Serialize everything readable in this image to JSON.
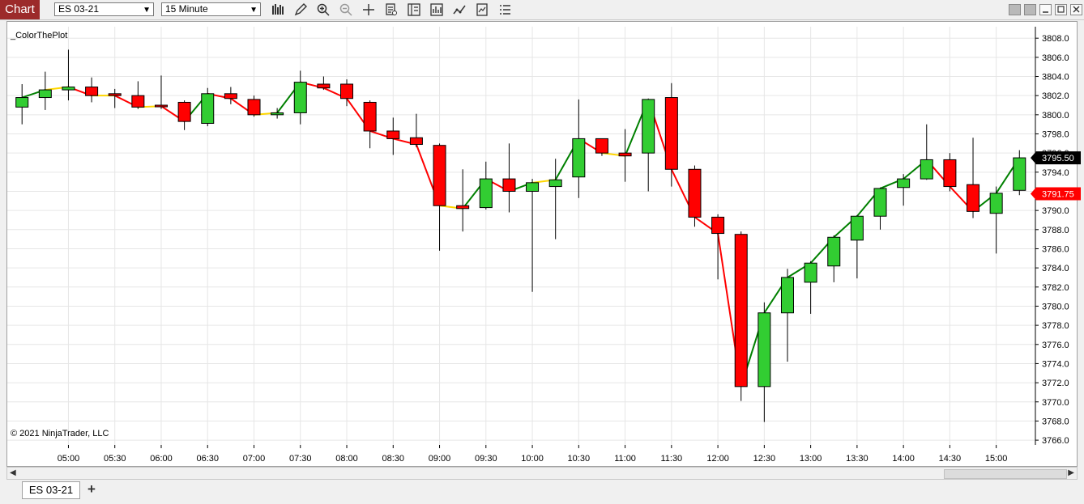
{
  "toolbar": {
    "chart_tab_label": "Chart",
    "instrument": "ES 03-21",
    "interval": "15 Minute"
  },
  "chart": {
    "indicator_label": "_ColorThePlot",
    "copyright": "© 2021 NinjaTrader, LLC"
  },
  "bottom_tabs": {
    "active_tab": "ES 03-21",
    "add_tab": "+"
  },
  "chart_data": {
    "type": "candlestick",
    "ylim": [
      3765.5,
      3809.2
    ],
    "y_ticks": [
      3766,
      3768,
      3770,
      3772,
      3774,
      3776,
      3778,
      3780,
      3782,
      3784,
      3786,
      3788,
      3790,
      3792,
      3794,
      3796,
      3798,
      3800,
      3802,
      3804,
      3806,
      3808
    ],
    "x_tick_labels": [
      "05:00",
      "05:30",
      "06:00",
      "06:30",
      "07:00",
      "07:30",
      "08:00",
      "08:30",
      "09:00",
      "09:30",
      "10:00",
      "10:30",
      "11:00",
      "11:30",
      "12:00",
      "12:30",
      "13:00",
      "13:30",
      "14:00",
      "14:30",
      "15:00"
    ],
    "colors": {
      "up": "#32cd32",
      "down": "#ff0000",
      "up_line": "#008000",
      "down_line": "#ff0000",
      "neutral_line": "#ffd700",
      "grid": "#e6e6e6"
    },
    "candles": [
      {
        "o": 3800.8,
        "h": 3803.2,
        "l": 3799.0,
        "c": 3801.8
      },
      {
        "o": 3801.8,
        "h": 3804.5,
        "l": 3800.5,
        "c": 3802.6
      },
      {
        "o": 3802.6,
        "h": 3806.8,
        "l": 3801.5,
        "c": 3802.9
      },
      {
        "o": 3802.9,
        "h": 3803.9,
        "l": 3801.3,
        "c": 3802.0
      },
      {
        "o": 3802.2,
        "h": 3802.7,
        "l": 3800.7,
        "c": 3802.0
      },
      {
        "o": 3802.0,
        "h": 3803.5,
        "l": 3800.6,
        "c": 3800.8
      },
      {
        "o": 3801.0,
        "h": 3804.1,
        "l": 3800.6,
        "c": 3800.9
      },
      {
        "o": 3801.3,
        "h": 3801.5,
        "l": 3798.4,
        "c": 3799.3
      },
      {
        "o": 3799.1,
        "h": 3802.8,
        "l": 3798.8,
        "c": 3802.2
      },
      {
        "o": 3802.2,
        "h": 3802.9,
        "l": 3801.1,
        "c": 3801.7
      },
      {
        "o": 3801.6,
        "h": 3802.0,
        "l": 3799.8,
        "c": 3800.0
      },
      {
        "o": 3800.0,
        "h": 3800.7,
        "l": 3799.6,
        "c": 3800.2
      },
      {
        "o": 3800.2,
        "h": 3804.6,
        "l": 3799.0,
        "c": 3803.4
      },
      {
        "o": 3803.2,
        "h": 3804.0,
        "l": 3802.6,
        "c": 3802.8
      },
      {
        "o": 3803.2,
        "h": 3803.7,
        "l": 3800.9,
        "c": 3801.7
      },
      {
        "o": 3801.3,
        "h": 3801.5,
        "l": 3796.5,
        "c": 3798.3
      },
      {
        "o": 3798.3,
        "h": 3799.7,
        "l": 3795.8,
        "c": 3797.5
      },
      {
        "o": 3797.6,
        "h": 3800.1,
        "l": 3796.6,
        "c": 3796.9
      },
      {
        "o": 3796.8,
        "h": 3797.0,
        "l": 3785.8,
        "c": 3790.5
      },
      {
        "o": 3790.5,
        "h": 3794.3,
        "l": 3787.8,
        "c": 3790.2
      },
      {
        "o": 3790.3,
        "h": 3795.1,
        "l": 3790.1,
        "c": 3793.3
      },
      {
        "o": 3793.3,
        "h": 3797.0,
        "l": 3789.8,
        "c": 3792.0
      },
      {
        "o": 3792.0,
        "h": 3793.3,
        "l": 3781.5,
        "c": 3792.9
      },
      {
        "o": 3792.5,
        "h": 3795.4,
        "l": 3787.0,
        "c": 3793.2
      },
      {
        "o": 3793.5,
        "h": 3801.6,
        "l": 3791.3,
        "c": 3797.5
      },
      {
        "o": 3797.5,
        "h": 3797.5,
        "l": 3795.7,
        "c": 3796.0
      },
      {
        "o": 3796.0,
        "h": 3798.5,
        "l": 3793.0,
        "c": 3795.7
      },
      {
        "o": 3796.0,
        "h": 3801.7,
        "l": 3792.0,
        "c": 3801.6
      },
      {
        "o": 3801.8,
        "h": 3803.3,
        "l": 3792.5,
        "c": 3794.3
      },
      {
        "o": 3794.3,
        "h": 3794.7,
        "l": 3788.3,
        "c": 3789.3
      },
      {
        "o": 3789.3,
        "h": 3789.6,
        "l": 3782.8,
        "c": 3787.6
      },
      {
        "o": 3787.5,
        "h": 3787.8,
        "l": 3770.1,
        "c": 3771.6
      },
      {
        "o": 3771.6,
        "h": 3780.4,
        "l": 3767.9,
        "c": 3779.3
      },
      {
        "o": 3779.3,
        "h": 3783.9,
        "l": 3774.2,
        "c": 3783.0
      },
      {
        "o": 3782.5,
        "h": 3784.7,
        "l": 3779.2,
        "c": 3784.5
      },
      {
        "o": 3784.2,
        "h": 3787.4,
        "l": 3782.5,
        "c": 3787.2
      },
      {
        "o": 3786.9,
        "h": 3789.5,
        "l": 3782.9,
        "c": 3789.4
      },
      {
        "o": 3789.4,
        "h": 3792.4,
        "l": 3788.0,
        "c": 3792.3
      },
      {
        "o": 3792.4,
        "h": 3793.8,
        "l": 3790.5,
        "c": 3793.3
      },
      {
        "o": 3793.3,
        "h": 3799.0,
        "l": 3793.2,
        "c": 3795.3
      },
      {
        "o": 3795.3,
        "h": 3796.0,
        "l": 3792.0,
        "c": 3792.5
      },
      {
        "o": 3792.7,
        "h": 3797.6,
        "l": 3789.2,
        "c": 3789.9
      },
      {
        "o": 3789.7,
        "h": 3792.5,
        "l": 3785.5,
        "c": 3791.8
      },
      {
        "o": 3792.1,
        "h": 3796.3,
        "l": 3791.6,
        "c": 3795.5
      }
    ],
    "price_labels": [
      {
        "value": 3795.5,
        "text": "3795.50",
        "color": "#000000"
      },
      {
        "value": 3791.75,
        "text": "3791.75",
        "color": "#ff0000"
      }
    ]
  }
}
